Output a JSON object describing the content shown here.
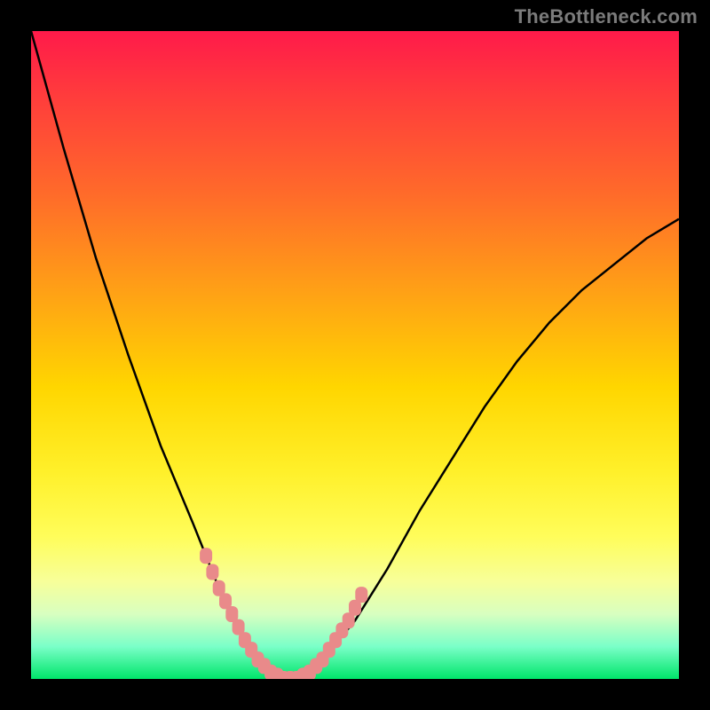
{
  "watermark": "TheBottleneck.com",
  "colors": {
    "background": "#000000",
    "curve": "#000000",
    "marker": "#e98a8a",
    "gradient_top": "#ff1a4a",
    "gradient_bottom": "#00e56a"
  },
  "chart_data": {
    "type": "line",
    "title": "",
    "xlabel": "",
    "ylabel": "",
    "xlim": [
      0,
      100
    ],
    "ylim": [
      0,
      100
    ],
    "grid": false,
    "legend": false,
    "series": [
      {
        "name": "bottleneck-curve",
        "x": [
          0,
          5,
          10,
          15,
          20,
          25,
          27,
          29,
          31,
          33,
          35,
          37,
          39,
          41,
          43,
          45,
          50,
          55,
          60,
          65,
          70,
          75,
          80,
          85,
          90,
          95,
          100
        ],
        "y": [
          100,
          82,
          65,
          50,
          36,
          24,
          19,
          14,
          10,
          6,
          3,
          1,
          0,
          0,
          1,
          3,
          9,
          17,
          26,
          34,
          42,
          49,
          55,
          60,
          64,
          68,
          71
        ]
      }
    ],
    "markers": {
      "name": "highlight-dots",
      "x": [
        27,
        28,
        29,
        30,
        31,
        32,
        33,
        34,
        35,
        36,
        37,
        38,
        39,
        40,
        41,
        42,
        43,
        44,
        45,
        46,
        47,
        48,
        49,
        50,
        51
      ],
      "y": [
        19,
        16.5,
        14,
        12,
        10,
        8,
        6,
        4.5,
        3,
        2,
        1,
        0.5,
        0,
        0,
        0,
        0.5,
        1,
        2,
        3,
        4.5,
        6,
        7.5,
        9,
        11,
        13
      ]
    }
  }
}
